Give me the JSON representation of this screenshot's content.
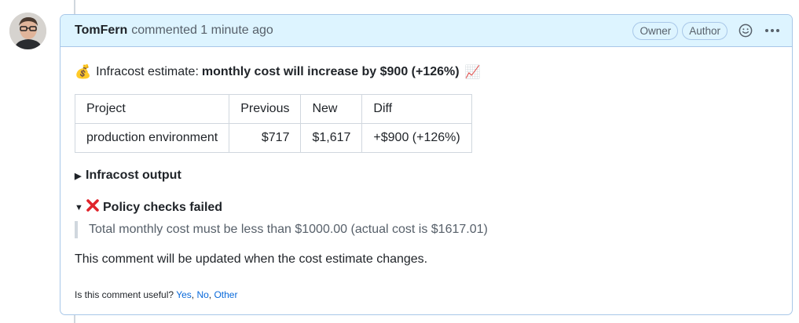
{
  "comment": {
    "author": "TomFern",
    "action": "commented 1 minute ago",
    "badges": [
      "Owner",
      "Author"
    ],
    "icons": {
      "reaction": "smiley-icon",
      "menu": "kebab-menu-icon"
    }
  },
  "body": {
    "headline_prefix": "Infracost estimate:",
    "headline_bold": "monthly cost will increase by $900 (+126%)",
    "headline_emoji_left": "💰",
    "headline_emoji_right": "📈",
    "table": {
      "headers": [
        "Project",
        "Previous",
        "New",
        "Diff"
      ],
      "rows": [
        [
          "production environment",
          "$717",
          "$1,617",
          "+$900 (+126%)"
        ]
      ]
    },
    "infracost_output": "Infracost output",
    "policy_title": "Policy checks failed",
    "policy_message": "Total monthly cost must be less than $1000.00 (actual cost is $1617.01)",
    "update_note": "This comment will be updated when the cost estimate changes.",
    "feedback_question": "Is this comment useful?",
    "feedback_links": [
      "Yes",
      "No",
      "Other"
    ]
  },
  "colors": {
    "header_bg": "#ddf4ff",
    "border": "#a8c7e8",
    "link": "#0969da",
    "muted": "#57606a"
  }
}
